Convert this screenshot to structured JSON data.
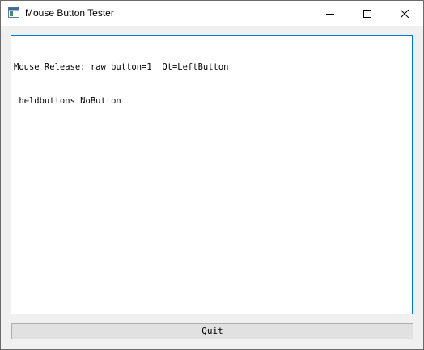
{
  "window": {
    "title": "Mouse Button Tester",
    "icon": "app-window-icon",
    "controls": {
      "minimize_icon": "minimize-icon",
      "maximize_icon": "maximize-icon",
      "close_icon": "close-icon"
    }
  },
  "log": {
    "lines": [
      "Mouse Release: raw button=1  Qt=LeftButton",
      " heldbuttons NoButton"
    ]
  },
  "quit": {
    "label": "Quit"
  },
  "colors": {
    "focus_border": "#0078d7",
    "button_face": "#e1e1e1",
    "window_bg": "#f0f0f0"
  }
}
